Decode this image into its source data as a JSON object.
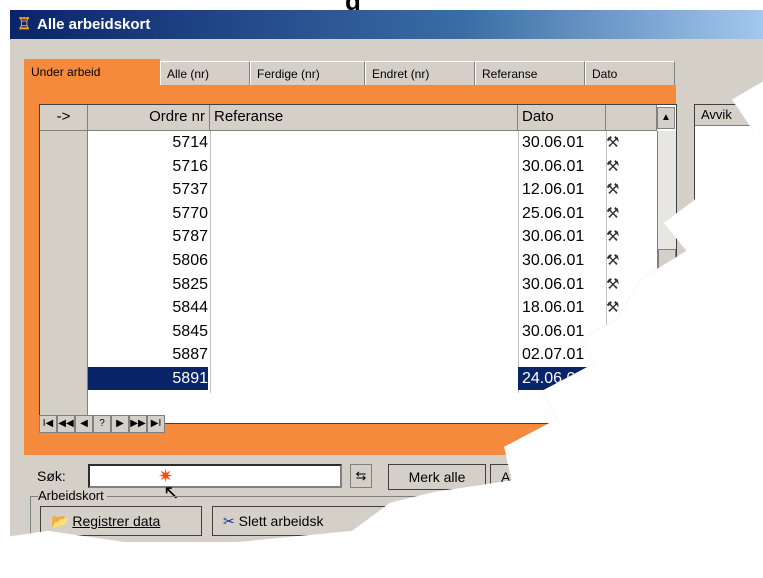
{
  "page": {
    "partial_heading": "g"
  },
  "window": {
    "title": "Alle arbeidskort"
  },
  "tabs": [
    {
      "label": "Under arbeid",
      "active": true
    },
    {
      "label": "Alle (nr)"
    },
    {
      "label": "Ferdige (nr)"
    },
    {
      "label": "Endret (nr)"
    },
    {
      "label": "Referanse"
    },
    {
      "label": "Dato"
    }
  ],
  "grid": {
    "columns": {
      "indicator": "->",
      "ordre": "Ordre nr",
      "referanse": "Referanse",
      "dato": "Dato"
    },
    "rows": [
      {
        "ordre": "5714",
        "dato": "30.06.01"
      },
      {
        "ordre": "5716",
        "dato": "30.06.01"
      },
      {
        "ordre": "5737",
        "dato": "12.06.01"
      },
      {
        "ordre": "5770",
        "dato": "25.06.01"
      },
      {
        "ordre": "5787",
        "dato": "30.06.01"
      },
      {
        "ordre": "5806",
        "dato": "30.06.01"
      },
      {
        "ordre": "5825",
        "dato": "30.06.01"
      },
      {
        "ordre": "5844",
        "dato": "18.06.01"
      },
      {
        "ordre": "5845",
        "dato": "30.06.01"
      },
      {
        "ordre": "5887",
        "dato": "02.07.01"
      },
      {
        "ordre": "5891",
        "dato": "24.06.0",
        "selected": true
      }
    ],
    "tool_icon": "hammer-icon"
  },
  "nav": {
    "buttons": [
      "I◀",
      "◀◀",
      "◀",
      "?",
      "▶",
      "▶▶",
      "▶I"
    ]
  },
  "side": {
    "avvik_header": "Avvik"
  },
  "search": {
    "label": "Søk:",
    "value": "",
    "merk_alle": "Merk alle",
    "avvik_btn": "Avvi"
  },
  "arbeidskort": {
    "group_label": "Arbeidskort",
    "registrer": "Registrer data",
    "slett": "Slett arbeidsk"
  },
  "colors": {
    "accent": "#f58a3c",
    "selection": "#0a246a",
    "titlebar": "#0a246a"
  }
}
